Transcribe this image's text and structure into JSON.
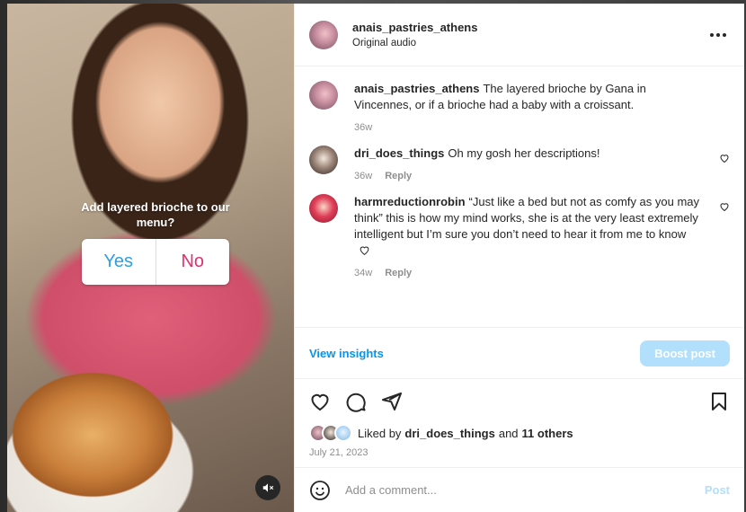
{
  "poll": {
    "question": "Add layered brioche to our menu?",
    "yes_label": "Yes",
    "no_label": "No"
  },
  "header": {
    "username": "anais_pastries_athens",
    "audio": "Original audio"
  },
  "comments": [
    {
      "user": "anais_pastries_athens",
      "text": "The layered brioche by Gana in Vincennes, or if a brioche had a baby with a croissant.",
      "time": "36w"
    },
    {
      "user": "dri_does_things",
      "text": "Oh my gosh her descriptions!",
      "time": "36w",
      "reply": "Reply"
    },
    {
      "user": "harmreductionrobin",
      "text": "“Just like a bed but not as comfy as you may think” this is how my mind works, she is at the very least extremely intelligent but I’m sure you don’t need to hear it from me to know",
      "time": "34w",
      "reply": "Reply"
    }
  ],
  "insights": {
    "link": "View insights",
    "boost": "Boost post"
  },
  "likes": {
    "prefix": "Liked by",
    "user": "dri_does_things",
    "and": "and",
    "others": "11 others"
  },
  "date": "July 21, 2023",
  "composer": {
    "placeholder": "Add a comment...",
    "post": "Post"
  },
  "colors": {
    "accent": "#0095f6",
    "boost_bg": "#b2dffc",
    "poll_yes": "#2fa0e0",
    "poll_no": "#e0306d"
  }
}
